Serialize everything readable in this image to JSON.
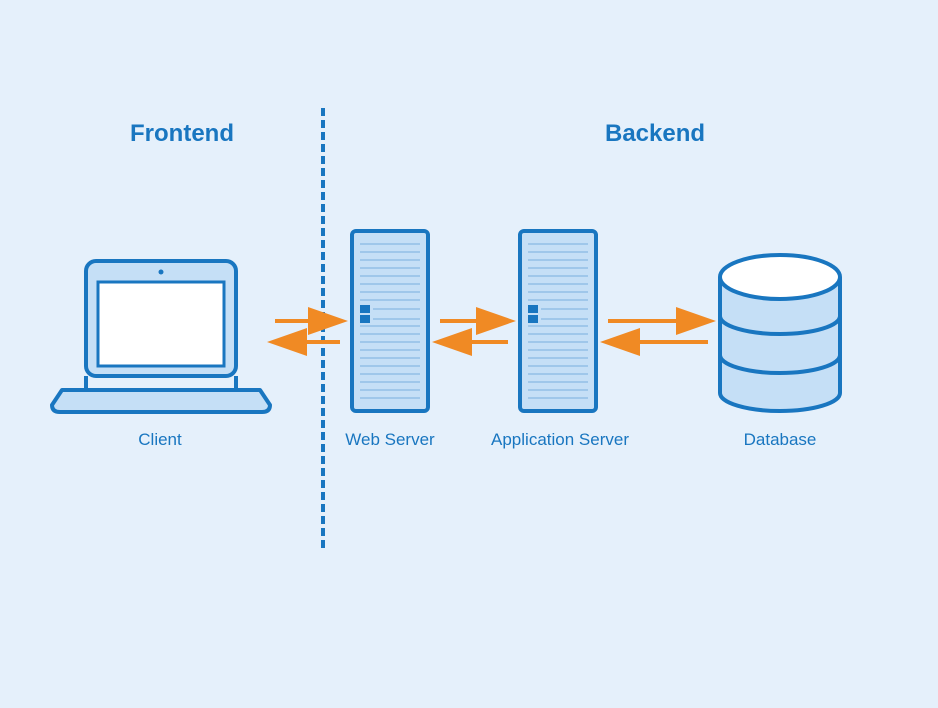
{
  "sections": {
    "frontend": "Frontend",
    "backend": "Backend"
  },
  "nodes": {
    "client": "Client",
    "web_server": "Web Server",
    "app_server": "Application Server",
    "database": "Database"
  },
  "colors": {
    "bg": "#e5f0fb",
    "stroke": "#1976c0",
    "fill_light": "#c5dff6",
    "fill_lighter": "#d3e7f8",
    "arrow": "#f08a24",
    "white": "#ffffff"
  },
  "layout": {
    "type": "architecture-diagram",
    "flow": [
      "Client",
      "Web Server",
      "Application Server",
      "Database"
    ],
    "bidirectional": true,
    "partition": {
      "frontend": [
        "Client"
      ],
      "backend": [
        "Web Server",
        "Application Server",
        "Database"
      ]
    }
  }
}
